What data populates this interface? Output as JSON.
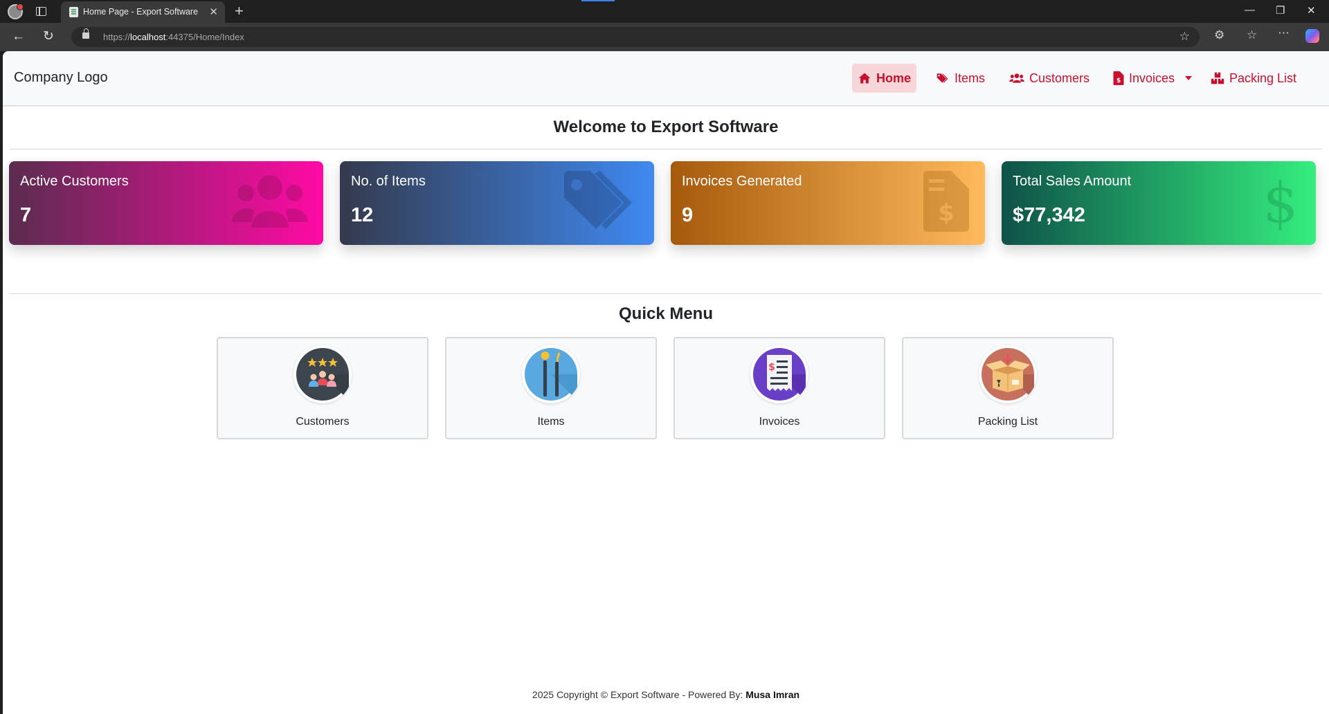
{
  "browser": {
    "tab_title": "Home Page - Export Software",
    "url_prefix": "https://",
    "url_host": "localhost",
    "url_rest": ":44375/Home/Index"
  },
  "navbar": {
    "brand": "Company Logo",
    "items": [
      {
        "label": "Home",
        "icon": "home-icon",
        "active": true
      },
      {
        "label": "Items",
        "icon": "tags-icon"
      },
      {
        "label": "Customers",
        "icon": "users-icon"
      },
      {
        "label": "Invoices",
        "icon": "invoice-icon",
        "dropdown": true
      },
      {
        "label": "Packing List",
        "icon": "boxes-icon"
      }
    ],
    "accent_color": "#c8102e",
    "active_bg": "#f8d7da"
  },
  "welcome": "Welcome to Export Software",
  "stats": [
    {
      "label": "Active Customers",
      "value": "7",
      "icon": "users-icon",
      "gradient": [
        "#5b2c4f",
        "#ff0aa5"
      ]
    },
    {
      "label": "No. of Items",
      "value": "12",
      "icon": "tags-icon",
      "gradient": [
        "#343a4d",
        "#3f89f2"
      ]
    },
    {
      "label": "Invoices Generated",
      "value": "9",
      "icon": "invoice-icon",
      "gradient": [
        "#a65a0c",
        "#ffba5c"
      ]
    },
    {
      "label": "Total Sales Amount",
      "value": "$77,342",
      "icon": "dollar-icon",
      "gradient": [
        "#0e5248",
        "#34ee7e"
      ]
    }
  ],
  "quick_menu": {
    "title": "Quick Menu",
    "items": [
      {
        "label": "Customers",
        "icon": "customers-rating-icon"
      },
      {
        "label": "Items",
        "icon": "items-icon"
      },
      {
        "label": "Invoices",
        "icon": "receipt-icon"
      },
      {
        "label": "Packing List",
        "icon": "open-box-icon"
      }
    ]
  },
  "footer": {
    "text": "2025 Copyright © Export Software - Powered By: ",
    "author": "Musa Imran"
  }
}
